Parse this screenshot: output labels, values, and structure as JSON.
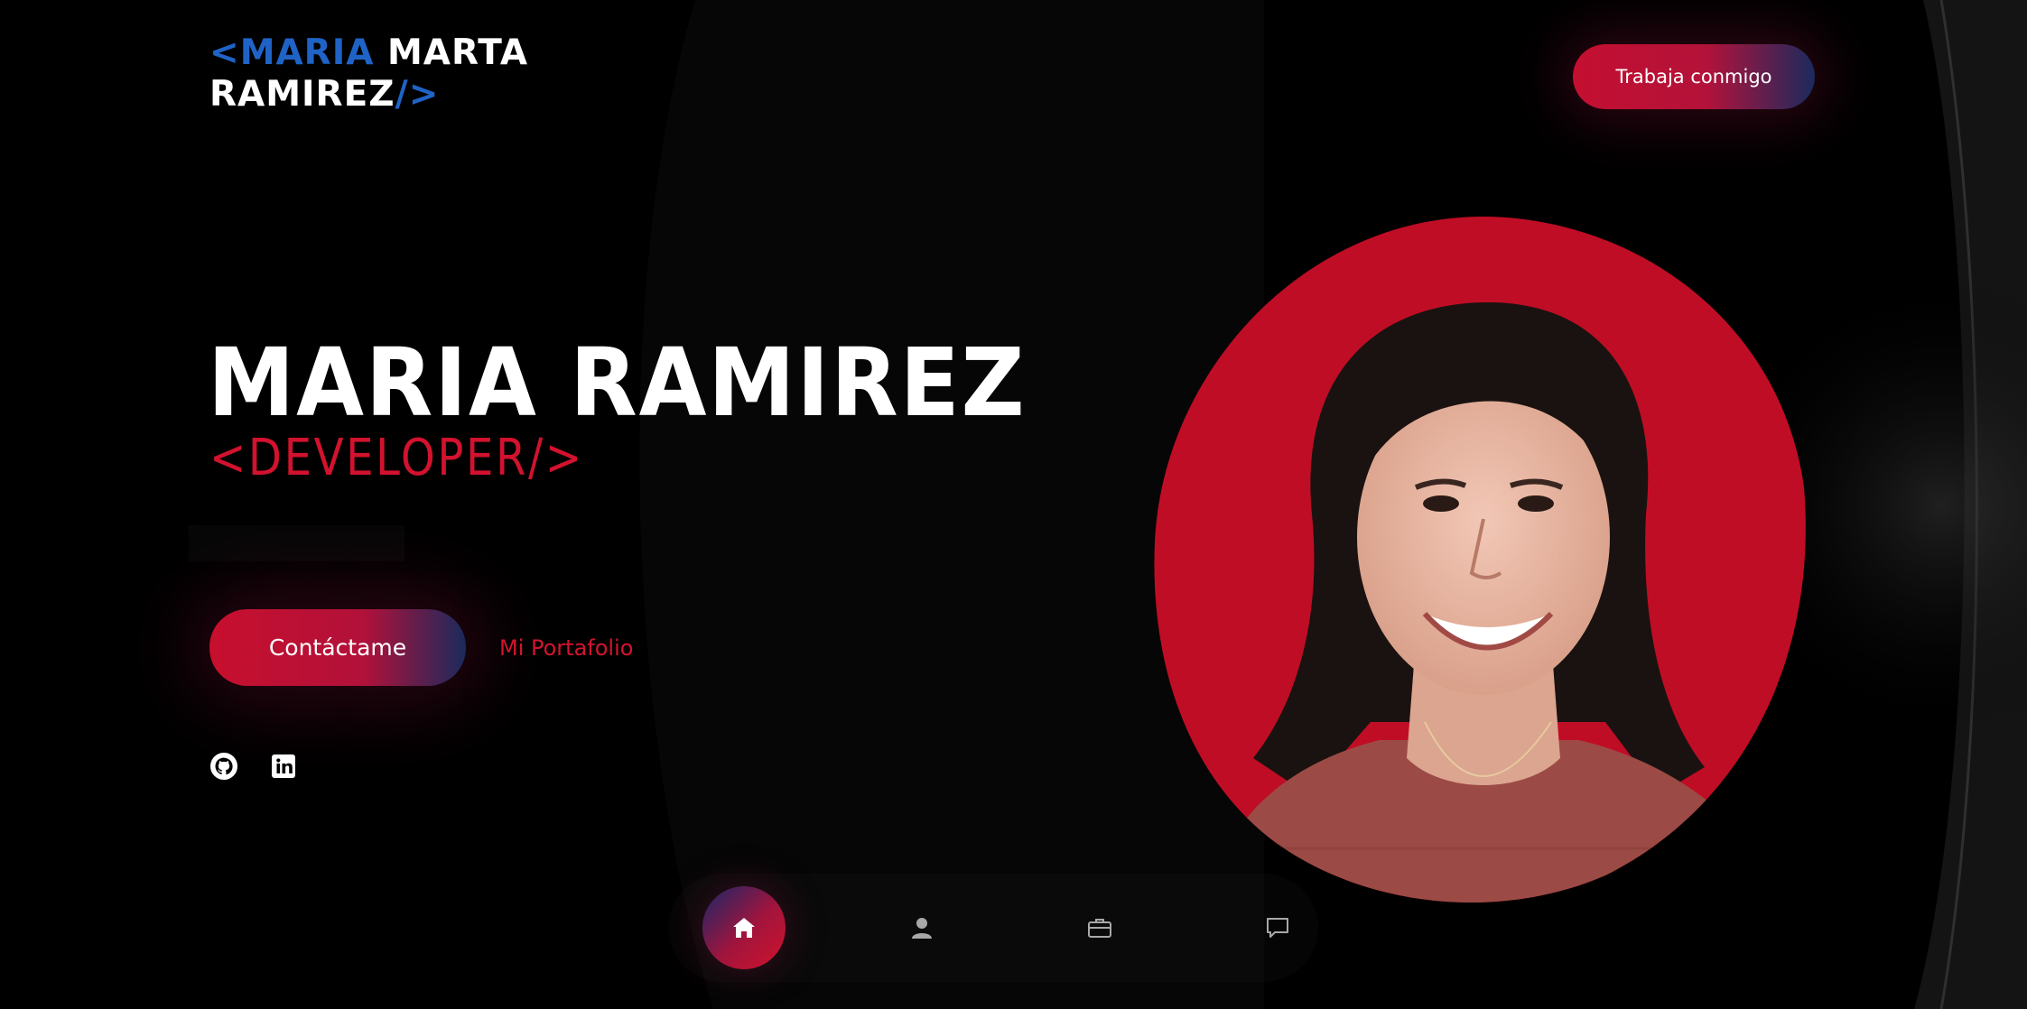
{
  "header": {
    "logo": {
      "open_bracket": "<",
      "first_name": "MARIA",
      "middle_name": "MARTA",
      "last_name": "RAMIREZ",
      "slash": "/",
      "close_bracket": ">"
    },
    "cta_label": "Trabaja conmigo"
  },
  "hero": {
    "name": "MARIA RAMIREZ",
    "role": "<DEVELOPER/>",
    "contact_label": "Contáctame",
    "portfolio_label": "Mi Portafolio"
  },
  "social": [
    {
      "icon": "github-icon"
    },
    {
      "icon": "linkedin-icon"
    }
  ],
  "bottom_nav": {
    "items": [
      {
        "icon": "home-icon",
        "active": true
      },
      {
        "icon": "user-icon",
        "active": false
      },
      {
        "icon": "briefcase-icon",
        "active": false
      },
      {
        "icon": "chat-icon",
        "active": false
      }
    ]
  },
  "colors": {
    "background": "#000000",
    "accent_red": "#d2122e",
    "accent_blue": "#1f63c6",
    "gradient_navy": "#1a2a5c",
    "text": "#ffffff"
  }
}
